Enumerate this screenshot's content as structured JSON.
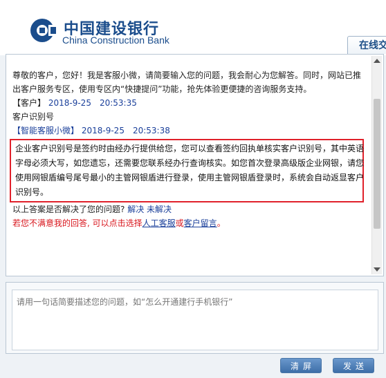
{
  "header": {
    "brand_cn": "中国建设银行",
    "brand_en": "China Construction Bank",
    "tab_label": "在线交"
  },
  "chat": {
    "greeting_line1": "尊敬的客户，您好！我是客服小微，请简要输入您的问题，我会耐心为您解答。同时，网站已推",
    "greeting_line2": "出客户服务专区，使用专区内“快捷提问”功能，抢先体验更便捷的咨询服务支持。",
    "customer_label": "【客户】",
    "customer_time": "2018-9-25　20:53:35",
    "customer_message": "客户识别号",
    "bot_label": "【智能客服小微】",
    "bot_time": "2018-9-25　20:53:38",
    "answer_lines": [
      "企业客户识别号是签约时由经办行提供给您，您可以查看签约回执单核实客户识别号，其中英语",
      "字母必须大写，如您遗忘，还需要您联系经办行查询核实。如您首次登录高级版企业网银，请您",
      "使用网银盾编号尾号最小的主管网银盾进行登录，使用主管网银盾登录时，系统会自动返显客户",
      "识别号。"
    ],
    "question_text": "以上答案是否解决了您的问题?",
    "solved_link": "解决",
    "unsolved_link": "未解决",
    "unsatisfied_text": "若您不满意我的回答, 可以点击选择",
    "human_service_link": "人工客服",
    "or_text": "或",
    "leave_message_link": "客户留言",
    "period": "。"
  },
  "input": {
    "placeholder": "请用一句话简要描述您的问题，如“怎么开通建行手机银行”"
  },
  "buttons": {
    "clear": "清屏",
    "send": "发送"
  },
  "colors": {
    "brand_blue": "#1b4d8c",
    "link_blue": "#1a3f9a",
    "highlight_red": "#e0202a",
    "button_blue": "#3d6ea8"
  }
}
